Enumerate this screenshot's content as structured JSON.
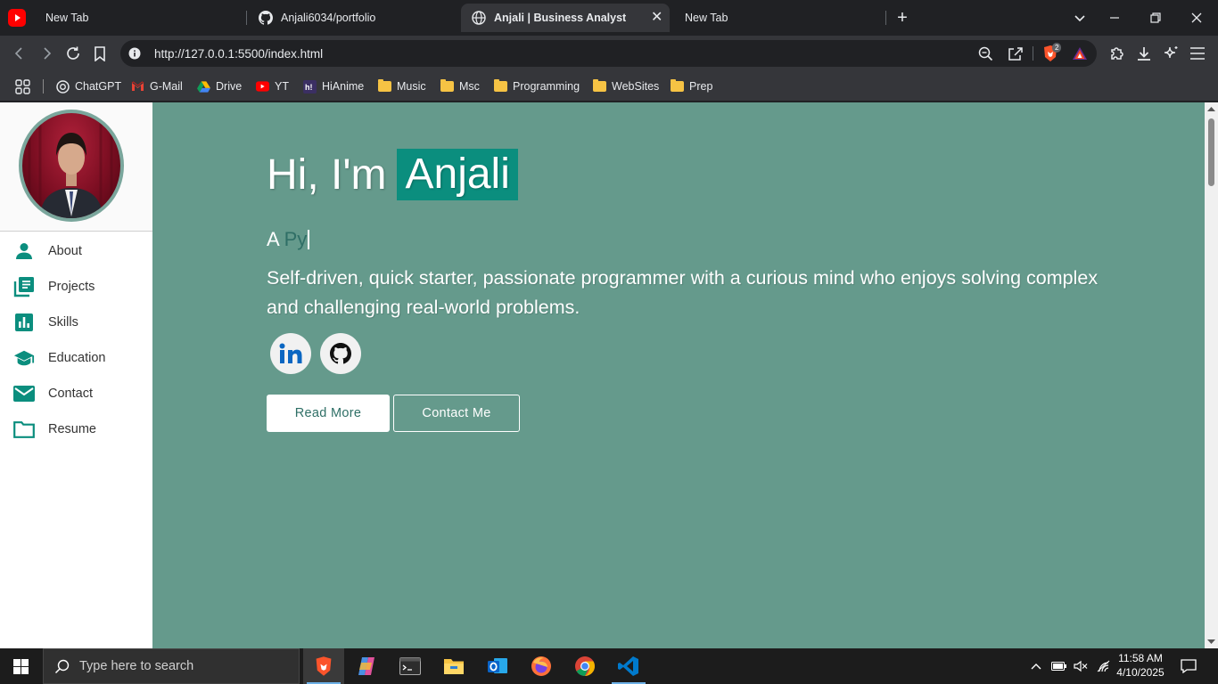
{
  "browser": {
    "tabs": [
      {
        "title": "New Tab",
        "favicon": "youtube-icon"
      },
      {
        "title": "Anjali6034/portfolio",
        "favicon": "github-icon"
      },
      {
        "title": "Anjali | Business Analyst",
        "favicon": "globe-icon",
        "active": true
      },
      {
        "title": "New Tab",
        "favicon": "none"
      }
    ],
    "url": "http://127.0.0.1:5500/index.html",
    "brave_badge": "2",
    "bookmarks": [
      {
        "label": "ChatGPT",
        "icon": "chatgpt-icon"
      },
      {
        "label": "G-Mail",
        "icon": "gmail-icon"
      },
      {
        "label": "Drive",
        "icon": "drive-icon"
      },
      {
        "label": "YT",
        "icon": "youtube-icon"
      },
      {
        "label": "HiAnime",
        "icon": "hianime-icon"
      },
      {
        "label": "Music",
        "icon": "folder-icon"
      },
      {
        "label": "Msc",
        "icon": "folder-icon"
      },
      {
        "label": "Programming",
        "icon": "folder-icon"
      },
      {
        "label": "WebSites",
        "icon": "folder-icon"
      },
      {
        "label": "Prep",
        "icon": "folder-icon"
      }
    ]
  },
  "sidebar": {
    "items": [
      {
        "label": "About",
        "icon": "person-icon"
      },
      {
        "label": "Projects",
        "icon": "projects-icon"
      },
      {
        "label": "Skills",
        "icon": "bar-chart-icon"
      },
      {
        "label": "Education",
        "icon": "graduation-cap-icon"
      },
      {
        "label": "Contact",
        "icon": "mail-icon"
      },
      {
        "label": "Resume",
        "icon": "folder-icon"
      }
    ]
  },
  "hero": {
    "greeting": "Hi, I'm",
    "name": "Anjali",
    "typed_prefix": "A",
    "typed_word": "Py",
    "description": "Self-driven, quick starter, passionate programmer with a curious mind who enjoys solving complex and challenging real-world problems.",
    "read_more": "Read More",
    "contact_me": "Contact Me"
  },
  "colors": {
    "page_bg": "#659a8c",
    "accent": "#0b8e7e",
    "sidebar_icon": "#0b8e7e"
  },
  "taskbar": {
    "search_placeholder": "Type here to search",
    "time": "11:58 AM",
    "date": "4/10/2025"
  }
}
